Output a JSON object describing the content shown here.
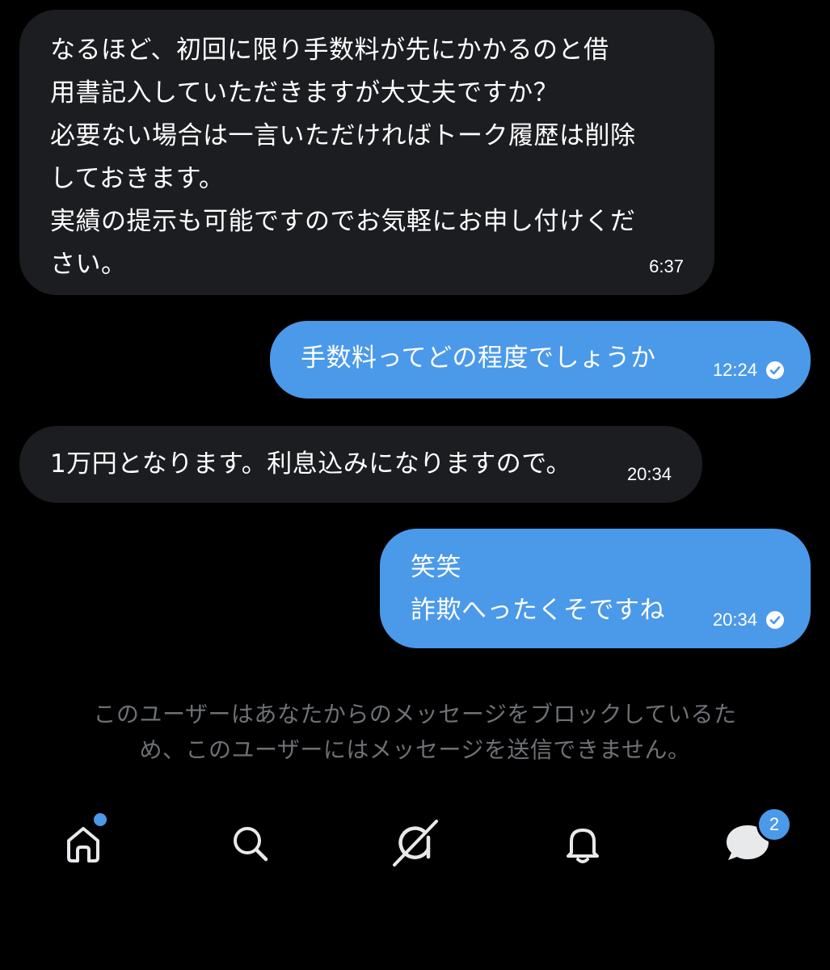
{
  "conversation": {
    "messages": [
      {
        "direction": "incoming",
        "text": "なるほど、初回に限り手数料が先にかかるのと借\n用書記入していただきますが大丈夫ですか？\n必要ない場合は一言いただければトーク履歴は削除\nしておきます。\n実績の提示も可能ですのでお気軽にお申し付けくだ\nさい。",
        "time": "6:37"
      },
      {
        "direction": "outgoing",
        "text": "手数料ってどの程度でしょうか",
        "time": "12:24",
        "read_icon": "check-circle-icon"
      },
      {
        "direction": "incoming",
        "text": "1万円となります。利息込みになりますので。",
        "time": "20:34"
      },
      {
        "direction": "outgoing",
        "text": "笑笑\n詐欺へったくそですね",
        "time": "20:34",
        "read_icon": "check-circle-icon"
      }
    ]
  },
  "block_notice": "このユーザーはあなたからのメッセージをブロックしているた\nめ、このユーザーにはメッセージを送信できません。",
  "tabbar": {
    "items": [
      {
        "name": "home",
        "icon": "home-icon",
        "has_dot": true
      },
      {
        "name": "search",
        "icon": "search-icon"
      },
      {
        "name": "grok",
        "icon": "grok-icon"
      },
      {
        "name": "notifications",
        "icon": "bell-icon"
      },
      {
        "name": "messages",
        "icon": "messages-icon",
        "badge": "2"
      }
    ]
  },
  "colors": {
    "background": "#000000",
    "incoming_bubble": "#1c1d21",
    "outgoing_bubble": "#4b99e9",
    "notice_text": "#6e7176",
    "icon": "#e7e9ea"
  }
}
